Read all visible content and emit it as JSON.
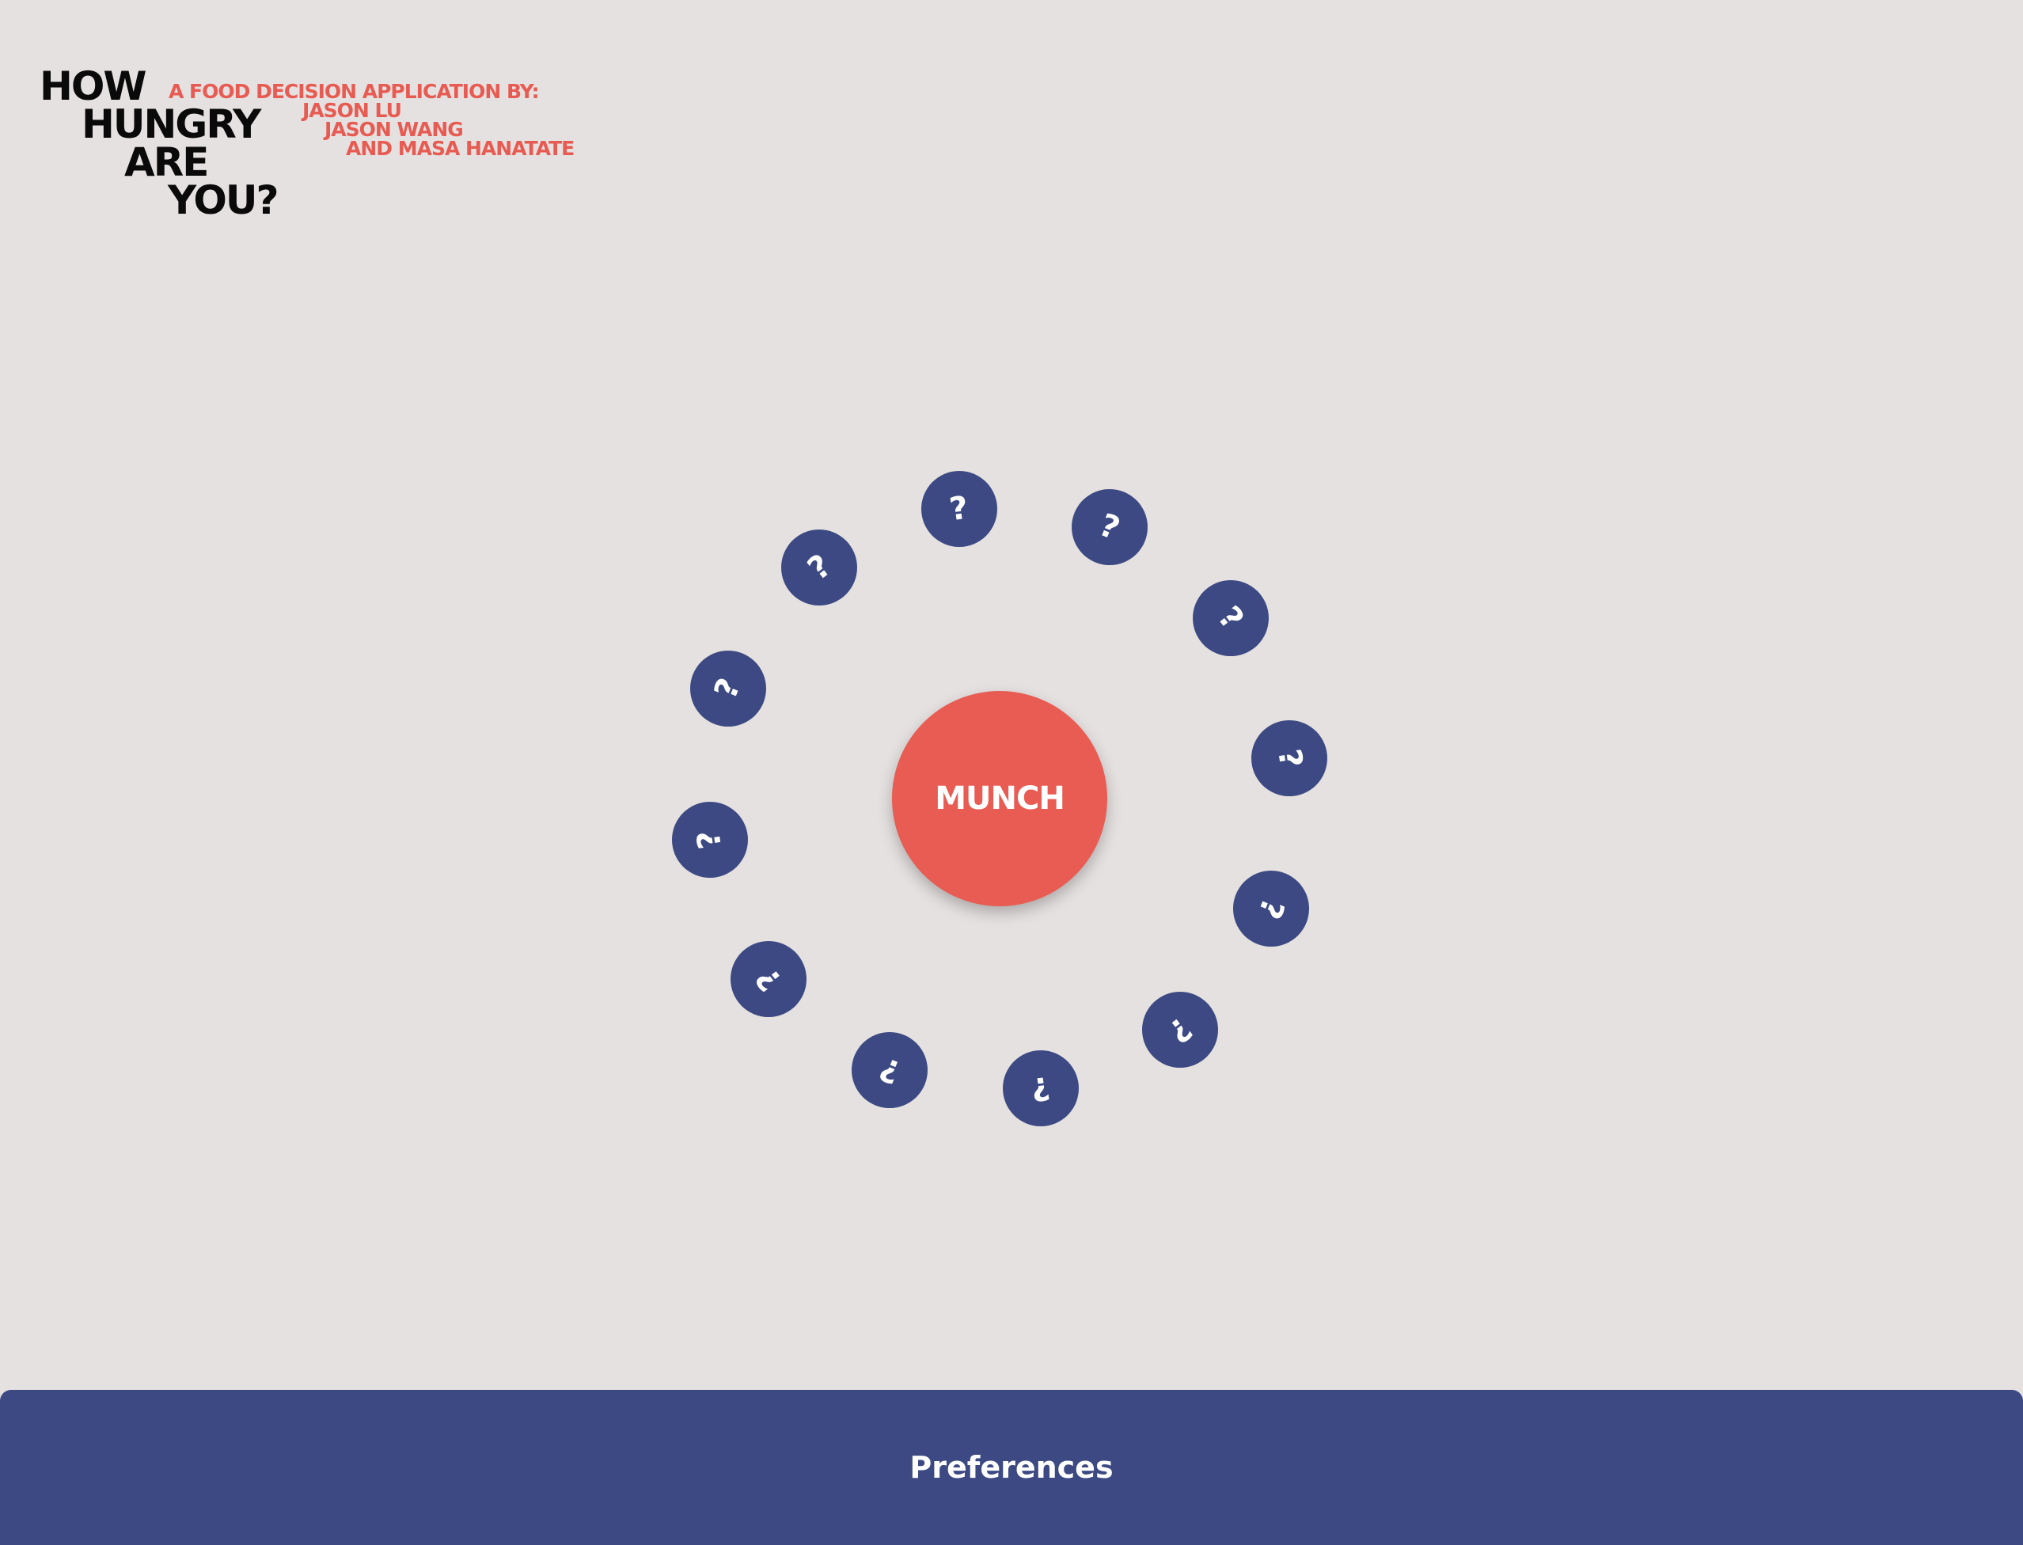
{
  "header": {
    "title_lines": [
      "HOW",
      "HUNGRY",
      "ARE",
      "YOU?"
    ],
    "credit_lines": [
      "A FOOD DECISION APPLICATION BY:",
      "JASON LU",
      "JASON WANG",
      "AND MASA HANATATE"
    ]
  },
  "wheel": {
    "center_label": "MUNCH",
    "options": [
      {
        "glyph": "?",
        "icon": "question-mark-icon"
      },
      {
        "glyph": "?",
        "icon": "question-mark-icon"
      },
      {
        "glyph": "?",
        "icon": "question-mark-icon"
      },
      {
        "glyph": "?",
        "icon": "question-mark-icon"
      },
      {
        "glyph": "?",
        "icon": "question-mark-icon"
      },
      {
        "glyph": "?",
        "icon": "question-mark-icon"
      },
      {
        "glyph": "?",
        "icon": "question-mark-icon"
      },
      {
        "glyph": "?",
        "icon": "question-mark-icon"
      },
      {
        "glyph": "?",
        "icon": "question-mark-icon"
      },
      {
        "glyph": "?",
        "icon": "question-mark-icon"
      },
      {
        "glyph": "?",
        "icon": "question-mark-icon"
      },
      {
        "glyph": "?",
        "icon": "question-mark-icon"
      }
    ]
  },
  "footer": {
    "preferences_label": "Preferences"
  },
  "colors": {
    "background": "#e5e1e0",
    "accent_red": "#e85c53",
    "navy": "#3c4982",
    "title_black": "#0a0a0a"
  }
}
